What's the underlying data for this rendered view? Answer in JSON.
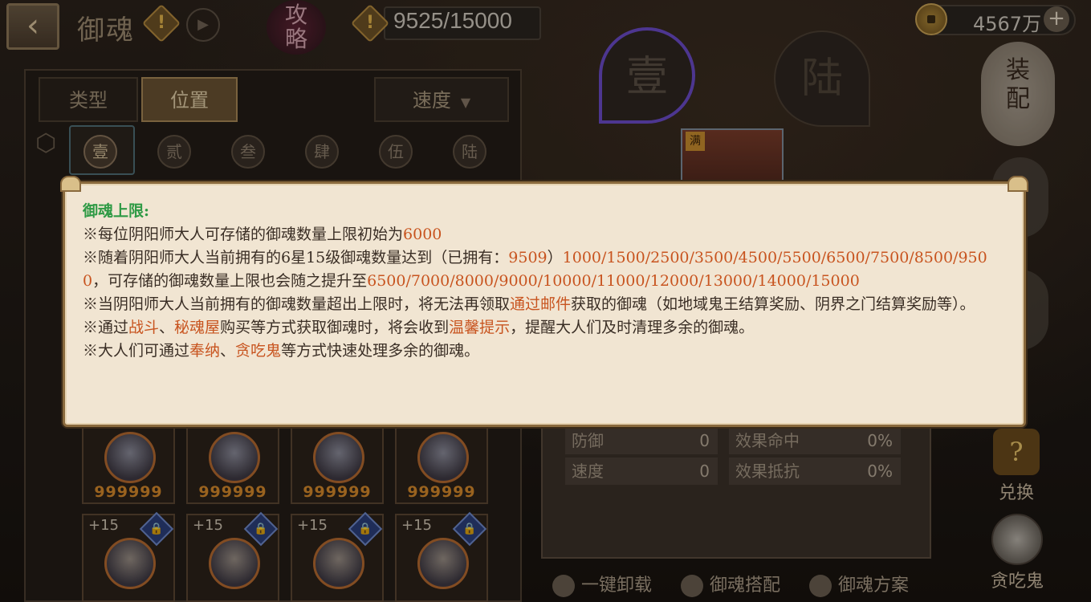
{
  "header": {
    "back_icon": "back-arrow-icon",
    "title": "御魂",
    "warn_glyph": "!",
    "strategy_label": "攻\n略",
    "capacity": "9525/15000",
    "coins": "4567万",
    "plus_glyph": "+"
  },
  "filters": {
    "type_label": "类型",
    "position_label": "位置",
    "sort_label": "速度",
    "sort_caret": "▼"
  },
  "slots": [
    "壹",
    "贰",
    "叁",
    "肆",
    "伍",
    "陆"
  ],
  "big_slots": {
    "one": "壹",
    "six": "陆"
  },
  "shikigami_badge": "满",
  "soul_cards_top": [
    {
      "qty": "999999"
    },
    {
      "qty": "999999"
    },
    {
      "qty": "999999"
    },
    {
      "qty": "999999"
    }
  ],
  "soul_cards_bottom": [
    {
      "level": "+15",
      "lock": "🔒"
    },
    {
      "level": "+15",
      "lock": "🔒"
    },
    {
      "level": "+15",
      "lock": "🔒"
    },
    {
      "level": "+15",
      "lock": "🔒"
    }
  ],
  "right_menu": {
    "equip_label": "装配",
    "exchange_label": "兑换",
    "exchange_glyph": "?",
    "glutton_label": "贪吃鬼"
  },
  "stats": [
    {
      "label": "防御",
      "value": "0"
    },
    {
      "label": "效果命中",
      "value": "0%"
    },
    {
      "label": "速度",
      "value": "0"
    },
    {
      "label": "效果抵抗",
      "value": "0%"
    }
  ],
  "bottom_actions": {
    "unload": "一键卸载",
    "match": "御魂搭配",
    "plan": "御魂方案"
  },
  "tooltip": {
    "title": "御魂上限:",
    "line1_a": "※每位阴阳师大人可存储的御魂数量上限初始为",
    "line1_b": "6000",
    "line2_a": "※随着阴阳师大人当前拥有的6星15级御魂数量达到（已拥有：",
    "line2_owned": "9509",
    "line2_b": "）",
    "line2_thresholds": "1000/1500/2500/3500/4500/5500/6500/7500/8500/9500",
    "line2_c": "，可存储的御魂数量上限也会随之提升至",
    "line2_caps": "6500/7000/8000/9000/10000/11000/12000/13000/14000/15000",
    "line3_a": "※当阴阳师大人当前拥有的御魂数量超出上限时，将无法再领取",
    "line3_hl": "通过邮件",
    "line3_b": "获取的御魂（如地域鬼王结算奖励、阴界之门结算奖励等）。",
    "line4_a": "※通过",
    "line4_hl1": "战斗",
    "line4_sep": "、",
    "line4_hl2": "秘魂屋",
    "line4_b": "购买等方式获取御魂时，将会收到",
    "line4_hl3": "温馨提示",
    "line4_c": "，提醒大人们及时清理多余的御魂。",
    "line5_a": "※大人们可通过",
    "line5_hl1": "奉纳",
    "line5_sep": "、",
    "line5_hl2": "贪吃鬼",
    "line5_b": "等方式快速处理多余的御魂。"
  }
}
